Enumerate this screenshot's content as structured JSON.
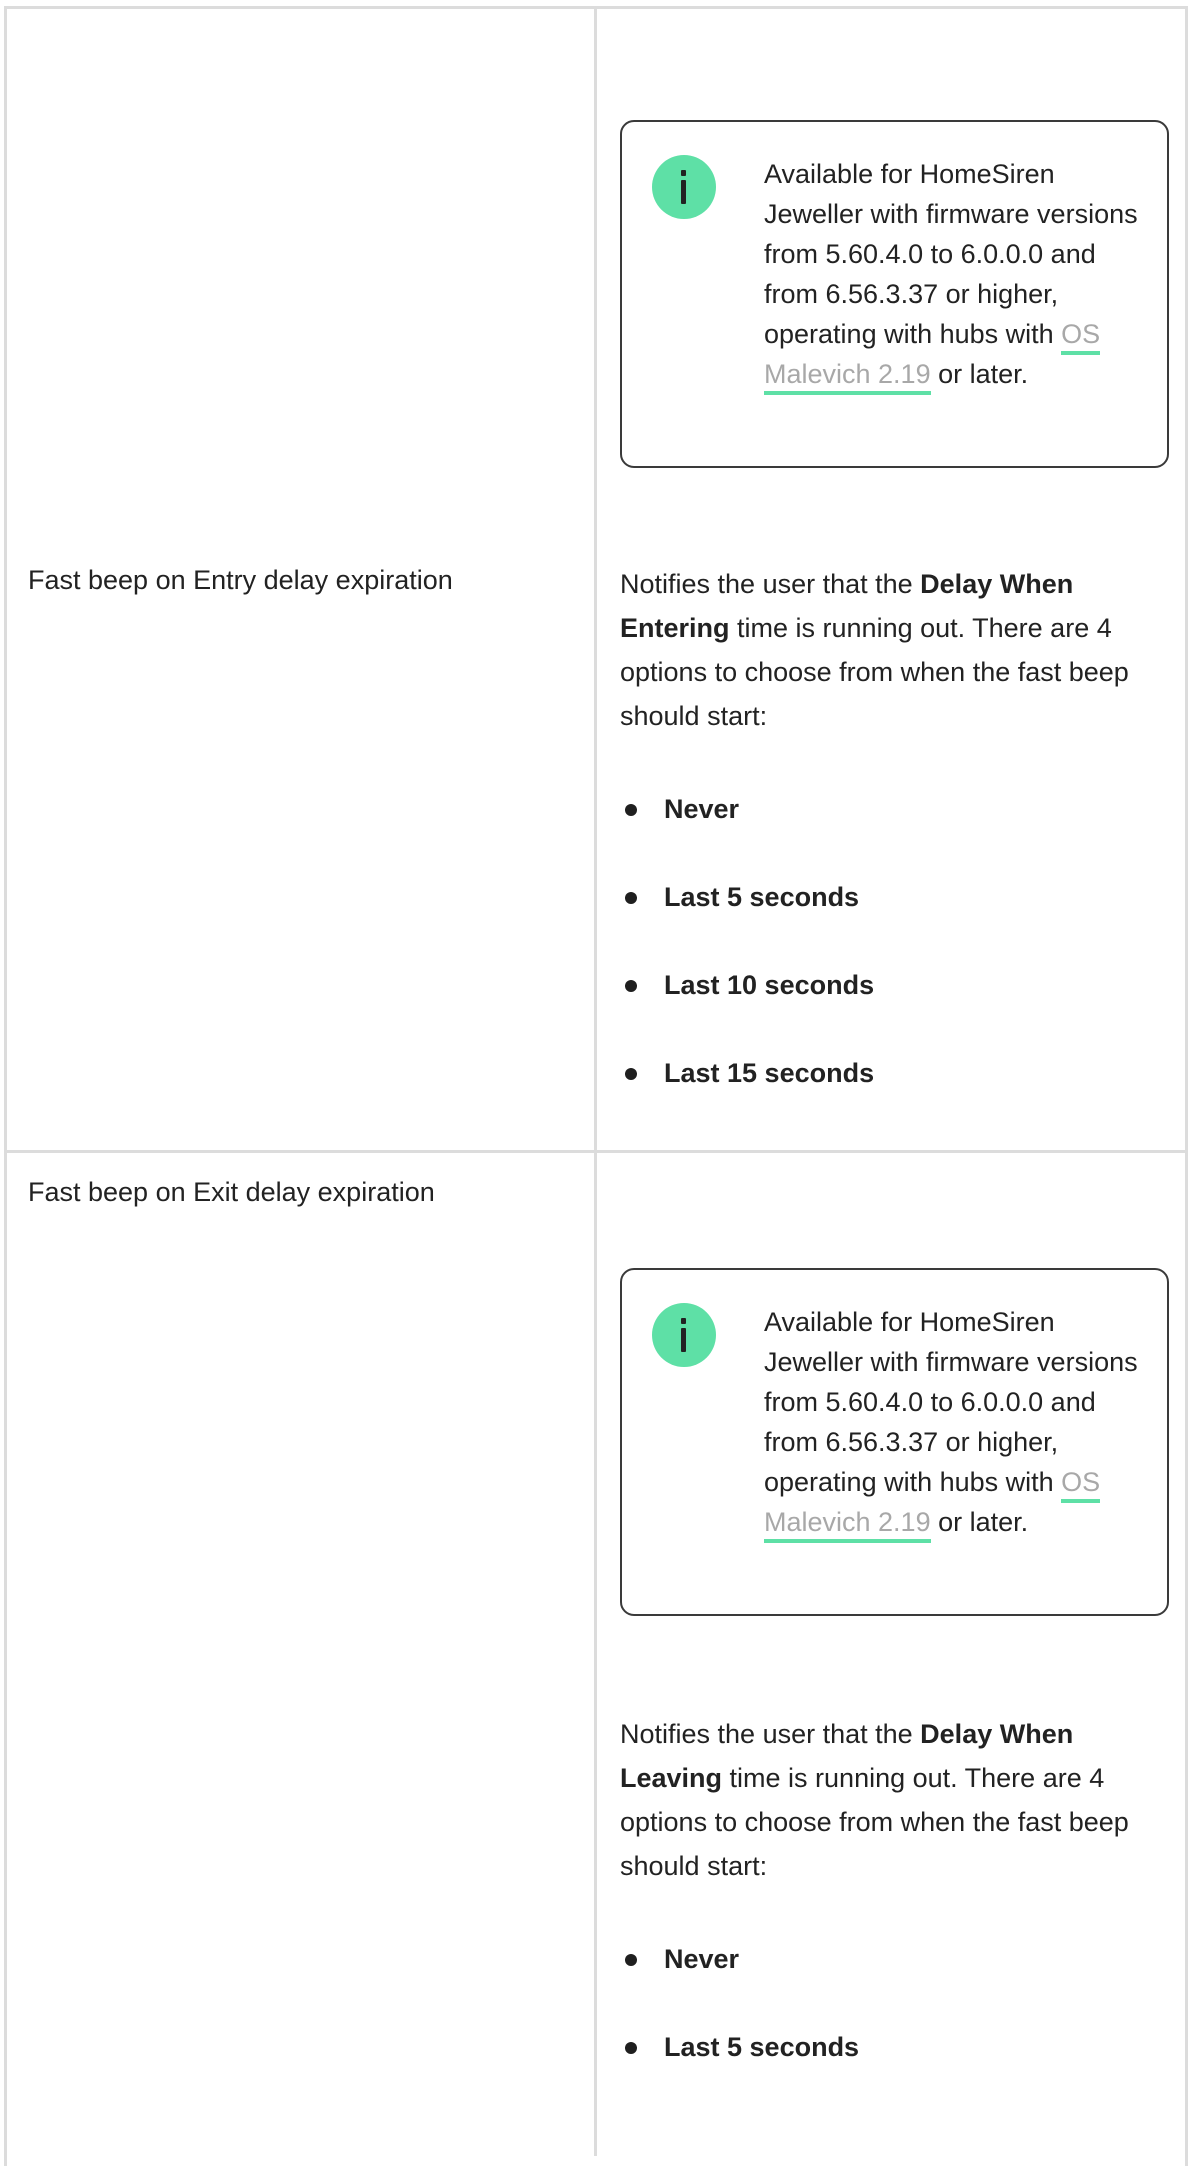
{
  "rows": [
    {
      "param": "",
      "note": {
        "icon": "info-icon",
        "text_before": "Available for HomeSiren Jeweller with firmware versions from 5.60.4.0 to 6.0.0.0 and from 6.56.3.37 or higher, operating with hubs with ",
        "link": "OS Malevich 2.19",
        "text_after": " or later."
      }
    },
    {
      "param": "Fast beep on Entry delay expiration",
      "description": {
        "before": "Notifies the user that the ",
        "bold": "Delay When Entering",
        "after": " time is running out. There are 4 options to choose from when the fast beep should start:"
      },
      "options": [
        "Never",
        "Last 5 seconds",
        "Last 10 seconds",
        "Last 15 seconds"
      ]
    },
    {
      "param": "Fast beep on Exit delay expiration",
      "note": {
        "icon": "info-icon",
        "text_before": "Available for HomeSiren Jeweller with firmware versions from 5.60.4.0 to 6.0.0.0 and from 6.56.3.37 or higher, operating with hubs with ",
        "link": "OS Malevich 2.19",
        "text_after": " or later."
      },
      "description": {
        "before": "Notifies the user that the ",
        "bold": "Delay When Leaving",
        "after": " time is running out. There are 4 options to choose from when the fast beep should start:"
      },
      "options": [
        "Never",
        "Last 5 seconds"
      ]
    }
  ],
  "colors": {
    "accent": "#5ee0a6",
    "border": "#dcdcdc",
    "link": "#a8a8a8"
  }
}
